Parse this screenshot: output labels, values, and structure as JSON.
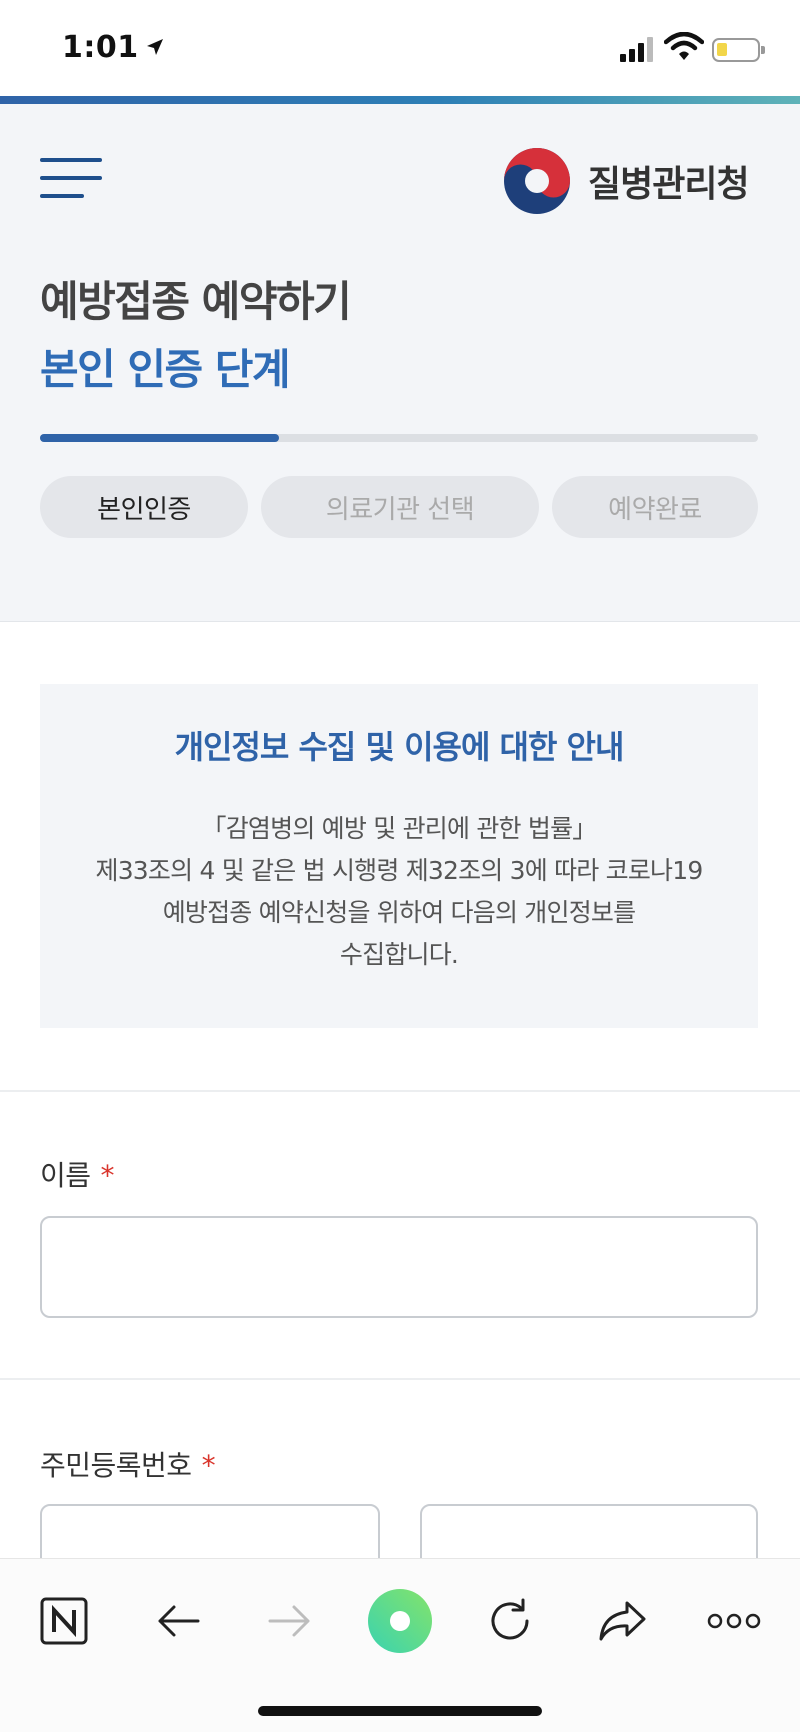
{
  "status_bar": {
    "time": "1:01"
  },
  "header": {
    "logo_text": "질병관리청",
    "title_line1": "예방접종 예약하기",
    "title_line2": "본인 인증 단계",
    "progress_fraction": 0.333,
    "steps": [
      {
        "label": "본인인증",
        "active": true
      },
      {
        "label": "의료기관 선택",
        "active": false
      },
      {
        "label": "예약완료",
        "active": false
      }
    ]
  },
  "notice": {
    "title": "개인정보 수집 및 이용에 대한 안내",
    "body_lines": [
      "「감염병의 예방 및 관리에 관한 법률」",
      "제33조의 4 및 같은 법 시행령 제32조의 3에 따라 코로나19",
      "예방접종 예약신청을 위하여 다음의 개인정보를",
      "수집합니다."
    ]
  },
  "form": {
    "name_label": "이름",
    "rrn_label": "주민등록번호",
    "required_mark": "*",
    "name_value": "",
    "rrn_front_value": "",
    "rrn_back_value": ""
  },
  "browser_toolbar": {
    "buttons": [
      "naver-icon",
      "back-arrow-icon",
      "forward-arrow-icon",
      "green-dot-icon",
      "reload-icon",
      "share-icon",
      "more-icon"
    ]
  },
  "colors": {
    "brand_blue": "#2f63a8",
    "title_blue": "#2f6cb6",
    "required_red": "#d9342b",
    "panel_bg": "#f3f5f8"
  }
}
